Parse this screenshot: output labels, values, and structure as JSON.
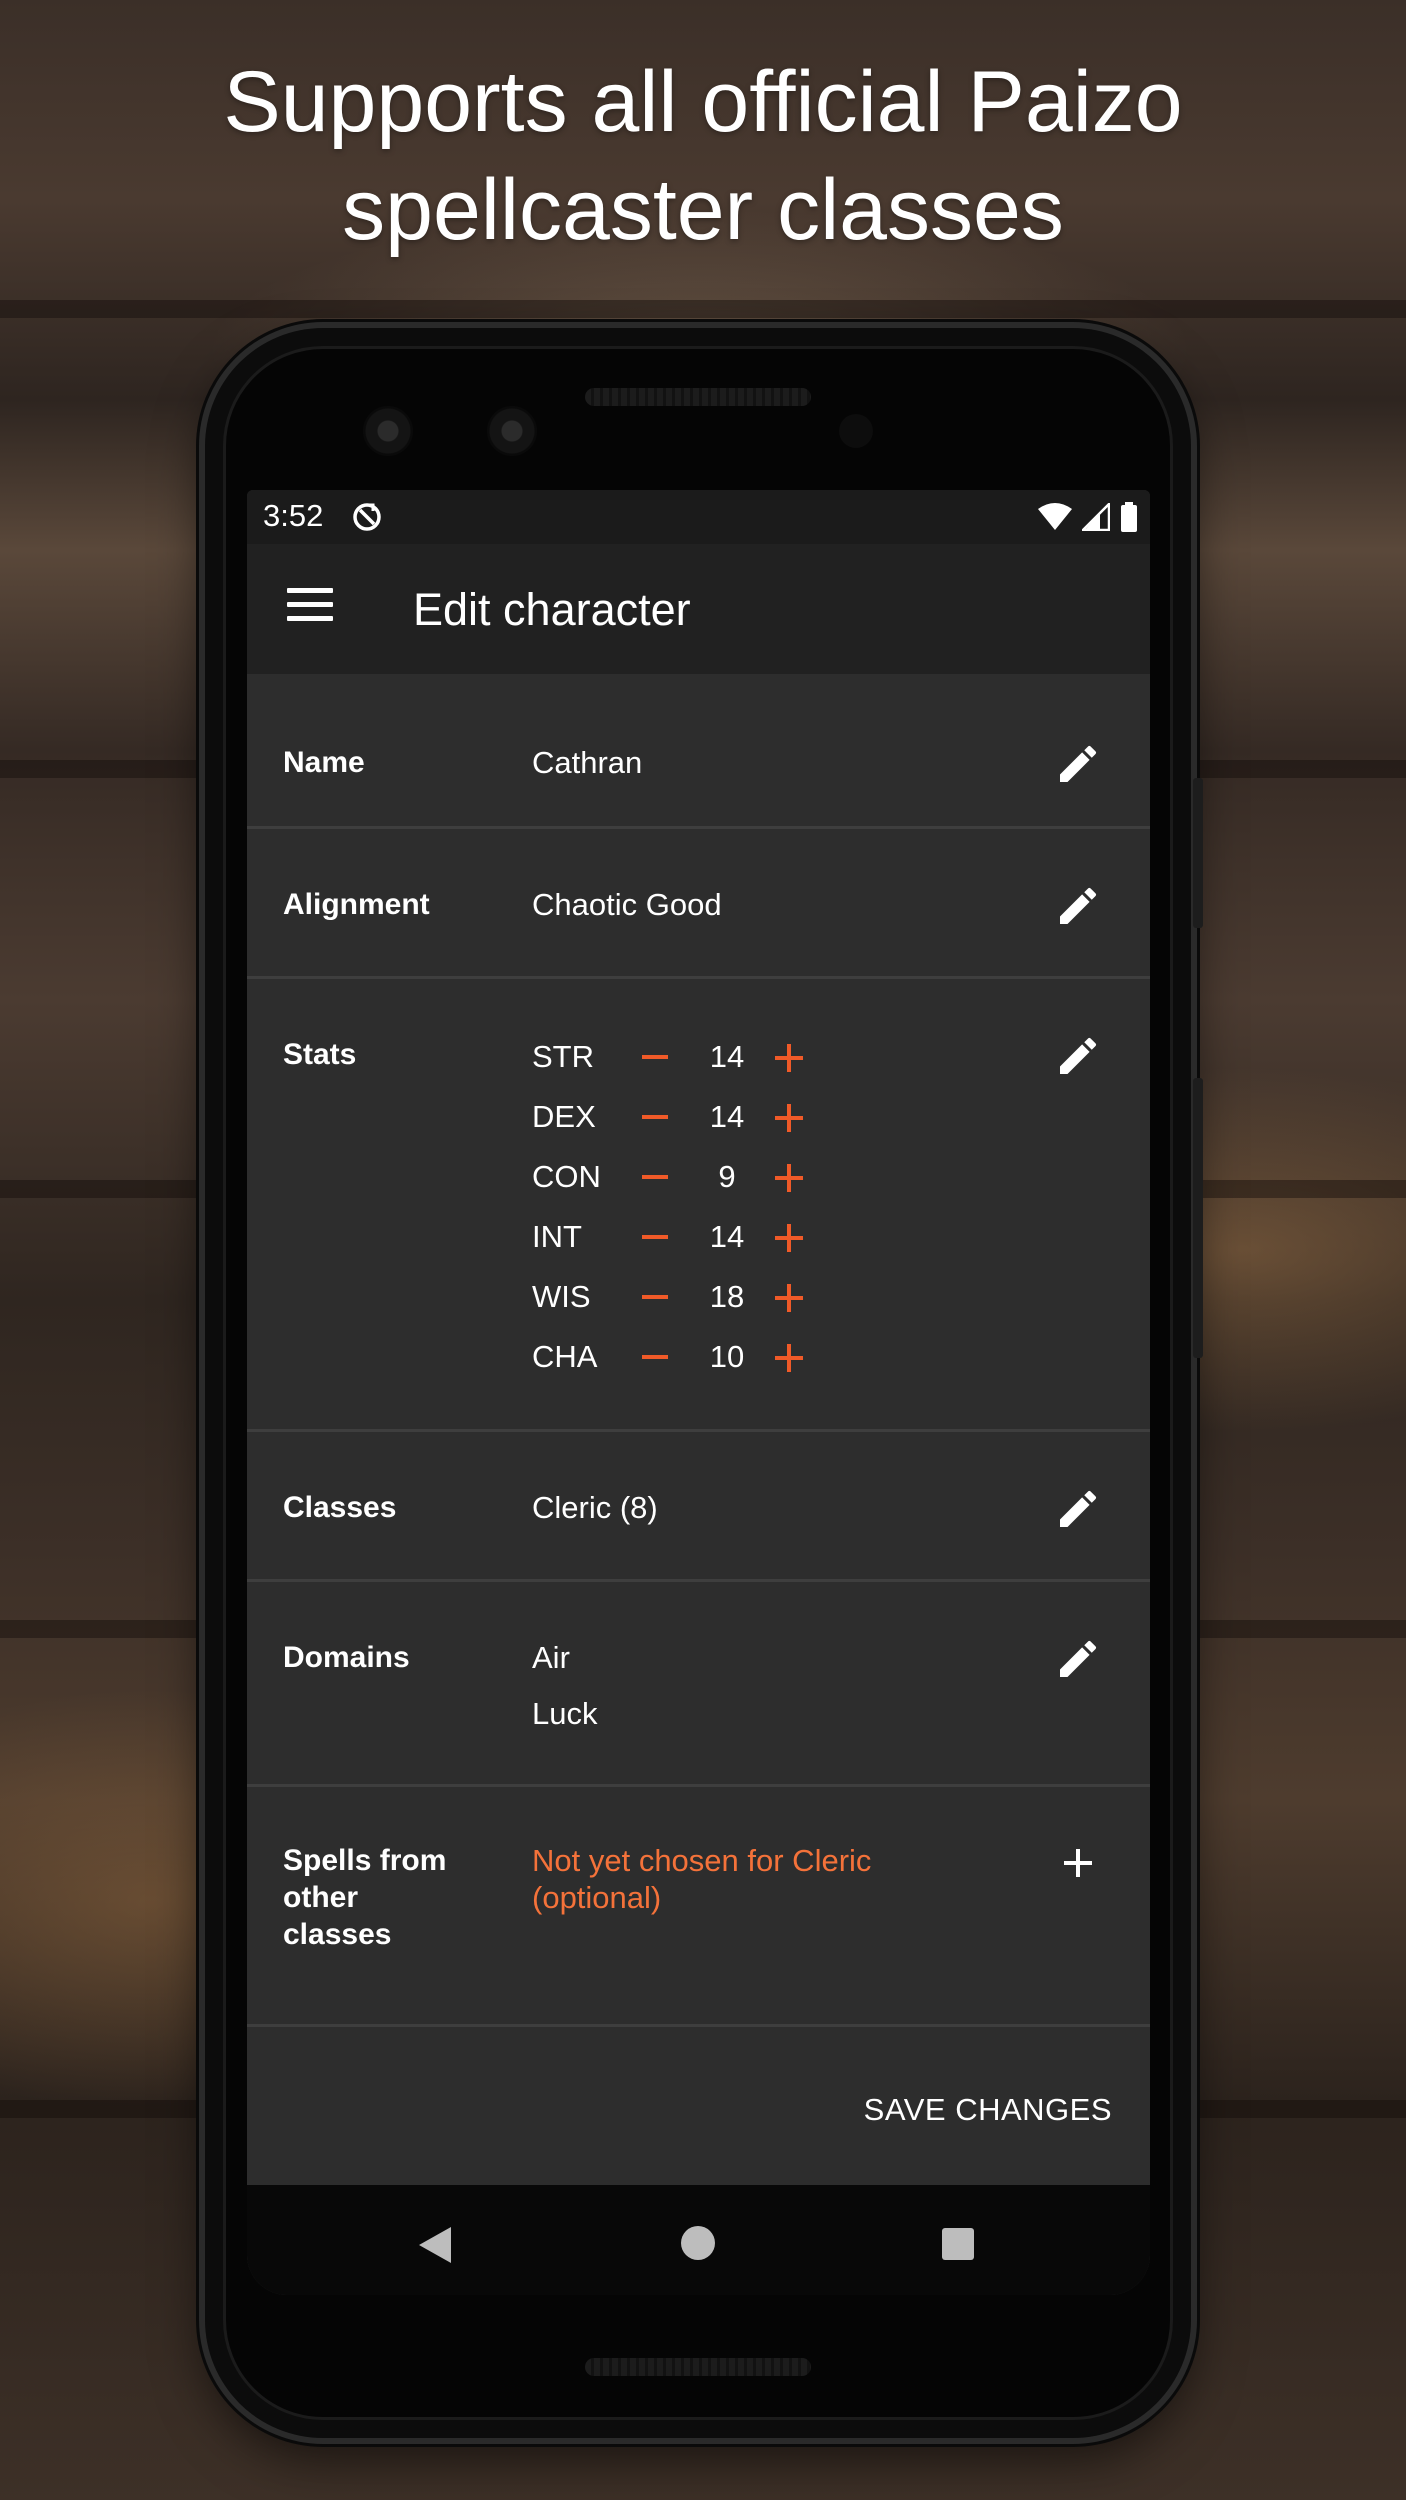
{
  "headline": {
    "line1": "Supports all official Paizo",
    "line2": "spellcaster classes"
  },
  "status_bar": {
    "time": "3:52",
    "icons": [
      "sync-icon",
      "wifi-icon",
      "signal-icon",
      "battery-icon"
    ]
  },
  "app_bar": {
    "menu_icon": "menu-icon",
    "title": "Edit character"
  },
  "fields": {
    "name": {
      "label": "Name",
      "value": "Cathran"
    },
    "alignment": {
      "label": "Alignment",
      "value": "Chaotic Good"
    },
    "stats": {
      "label": "Stats",
      "items": [
        {
          "abbr": "STR",
          "value": "14"
        },
        {
          "abbr": "DEX",
          "value": "14"
        },
        {
          "abbr": "CON",
          "value": "9"
        },
        {
          "abbr": "INT",
          "value": "14"
        },
        {
          "abbr": "WIS",
          "value": "18"
        },
        {
          "abbr": "CHA",
          "value": "10"
        }
      ]
    },
    "classes": {
      "label": "Classes",
      "value": "Cleric (8)"
    },
    "domains": {
      "label": "Domains",
      "values": [
        "Air",
        "Luck"
      ]
    },
    "other_spells": {
      "label_lines": [
        "Spells from",
        "other",
        "classes"
      ],
      "value_lines": [
        "Not yet chosen for Cleric",
        "(optional)"
      ]
    }
  },
  "actions": {
    "save_label": "SAVE CHANGES"
  },
  "colors": {
    "accent": "#f05a28",
    "surface": "#2d2d2d",
    "app_bar": "#212121",
    "status_bar": "#1b1b1b"
  }
}
